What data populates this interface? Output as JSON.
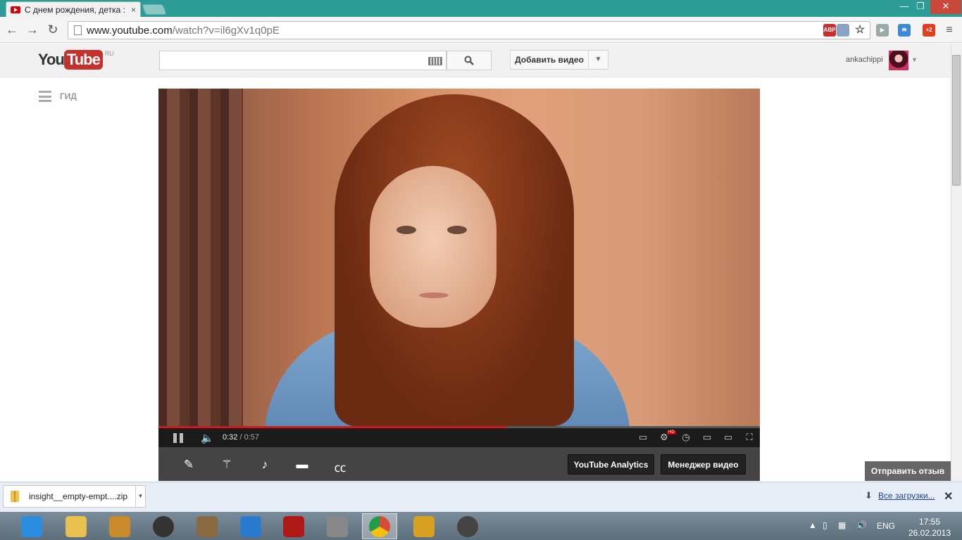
{
  "browser": {
    "tab_title": "С днем рождения, детка :",
    "tab_close": "×",
    "window_minimize": "—",
    "window_restore": "❐",
    "window_close": "✕",
    "url_host": "www.youtube.com",
    "url_path": "/watch?v=il6gXv1q0pE",
    "extensions": [
      {
        "name": "adblock-icon",
        "label": "ABP",
        "color": "#c9302c"
      },
      {
        "name": "page-action-icon",
        "label": "",
        "color": "#8aa3c2"
      },
      {
        "name": "star-icon",
        "label": "☆",
        "color": ""
      },
      {
        "name": "play-extension-icon",
        "label": "▶",
        "color": "#9aa"
      },
      {
        "name": "mail-extension-icon",
        "label": "✉",
        "color": "#3a8ad8"
      },
      {
        "name": "notification-extension-icon",
        "label": "+2",
        "color": "#e04020"
      },
      {
        "name": "menu-icon",
        "label": "≡",
        "color": ""
      }
    ]
  },
  "youtube": {
    "logo_you": "You",
    "logo_tube": "Tube",
    "logo_region": "RU",
    "search_placeholder": "",
    "add_video": "Добавить видео",
    "username": "ankachippi",
    "guide": "ГИД"
  },
  "player": {
    "current_time": "0:32",
    "separator": " / ",
    "duration": "0:57",
    "progress": 0.578,
    "hd_badge": "HD"
  },
  "creator_bar": {
    "analytics_button": "YouTube Analytics",
    "manager_button": "Менеджер видео",
    "feedback_button": "Отправить отзыв"
  },
  "downloads": {
    "file_name": "insight__empty-empt....zip",
    "show_all": "Все загрузки..."
  },
  "taskbar": {
    "language": "ENG",
    "time": "17:55",
    "date": "26.02.2013",
    "apps": [
      {
        "name": "internet-explorer-icon",
        "color": "#2b8de0"
      },
      {
        "name": "file-explorer-icon",
        "color": "#e8c050"
      },
      {
        "name": "media-app-icon",
        "color": "#c88a2a"
      },
      {
        "name": "speaker-app-icon",
        "color": "#333333"
      },
      {
        "name": "document-app-icon",
        "color": "#8a6a40"
      },
      {
        "name": "settings-app-icon",
        "color": "#2a7ad0"
      },
      {
        "name": "power-app-icon",
        "color": "#b01818"
      },
      {
        "name": "grid-app-icon",
        "color": "#888888"
      },
      {
        "name": "chrome-icon",
        "color": "#d94a38"
      },
      {
        "name": "winamp-icon",
        "color": "#d8a020"
      },
      {
        "name": "recording-app-icon",
        "color": "#444444"
      }
    ]
  }
}
